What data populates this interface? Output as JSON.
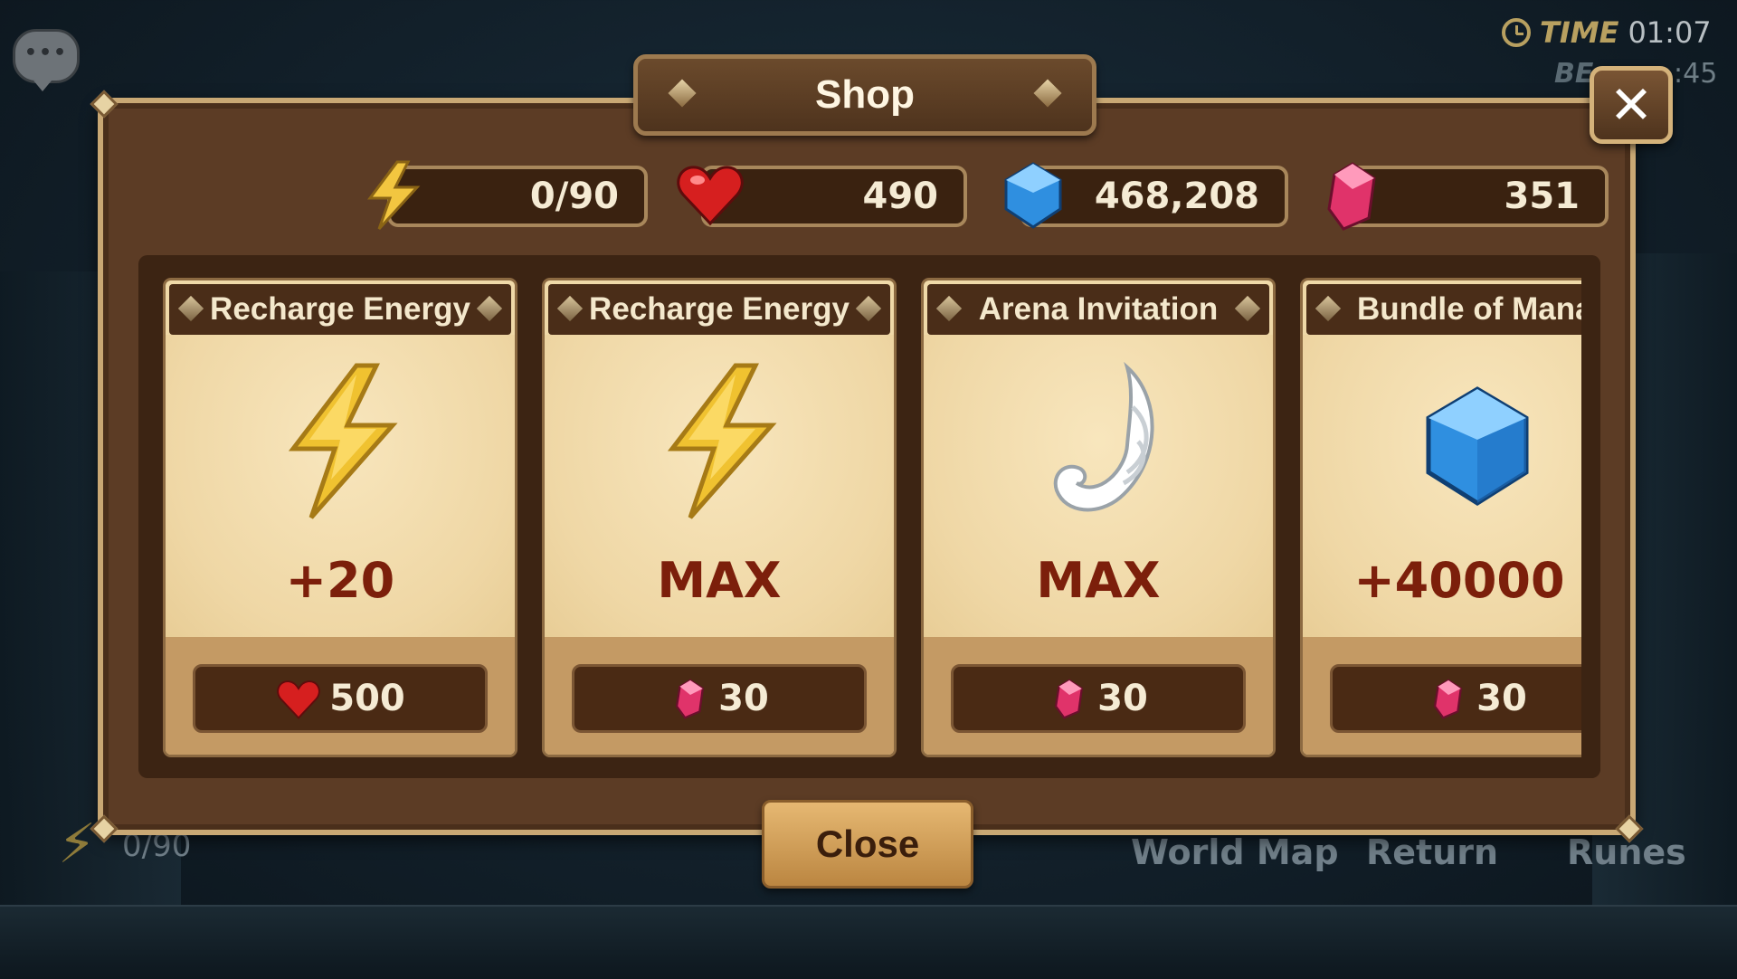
{
  "hud": {
    "time_label": "TIME",
    "time_value": "01:07",
    "partial_label": "BE",
    "partial_value": ":45",
    "bottom_energy": "0/90",
    "nav": [
      "World Map",
      "Return",
      "Runes"
    ]
  },
  "dialog": {
    "title": "Shop",
    "close_label": "Close",
    "close_x": "✕"
  },
  "currencies": [
    {
      "icon": "energy-icon",
      "value": "0/90"
    },
    {
      "icon": "heart-icon",
      "value": "490"
    },
    {
      "icon": "mana-crystal-icon",
      "value": "468,208"
    },
    {
      "icon": "ruby-crystal-icon",
      "value": "351"
    }
  ],
  "items": [
    {
      "title": "Recharge Energy",
      "icon": "energy-bolt-icon",
      "quantity": "+20",
      "price_icon": "heart-icon",
      "price": "500"
    },
    {
      "title": "Recharge Energy",
      "icon": "energy-bolt-icon",
      "quantity": "MAX",
      "price_icon": "ruby-crystal-icon",
      "price": "30"
    },
    {
      "title": "Arena Invitation",
      "icon": "wing-icon",
      "quantity": "MAX",
      "price_icon": "ruby-crystal-icon",
      "price": "30"
    },
    {
      "title": "Bundle of Mana",
      "icon": "mana-crystal-icon",
      "quantity": "+40000",
      "price_icon": "ruby-crystal-icon",
      "price": "30"
    }
  ],
  "colors": {
    "panel": "#5c3c25",
    "card": "#efd9a8",
    "quantity_text": "#7c1f0b",
    "accent_gold": "#c9a874"
  }
}
